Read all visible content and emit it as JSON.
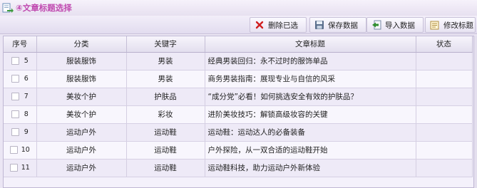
{
  "window": {
    "title": "④文章标题选择"
  },
  "toolbar": {
    "delete_label": "删除已选",
    "save_label": "保存数据",
    "import_label": "导入数据",
    "edit_label": "修改标题"
  },
  "table": {
    "headers": {
      "index": "序号",
      "category": "分类",
      "keyword": "关键字",
      "title": "文章标题",
      "status": "状态"
    },
    "rows": [
      {
        "index": "5",
        "category": "服装服饰",
        "keyword": "男装",
        "title": "经典男装回归：永不过时的服饰单品",
        "status": ""
      },
      {
        "index": "6",
        "category": "服装服饰",
        "keyword": "男装",
        "title": "商务男装指南：展现专业与自信的风采",
        "status": ""
      },
      {
        "index": "7",
        "category": "美妆个护",
        "keyword": "护肤品",
        "title": "“成分党”必看！如何挑选安全有效的护肤品？",
        "status": ""
      },
      {
        "index": "8",
        "category": "美妆个护",
        "keyword": "彩妆",
        "title": "进阶美妆技巧：解锁高级妆容的关键",
        "status": ""
      },
      {
        "index": "9",
        "category": "运动户外",
        "keyword": "运动鞋",
        "title": "运动鞋：运动达人的必备装备",
        "status": ""
      },
      {
        "index": "10",
        "category": "运动户外",
        "keyword": "运动鞋",
        "title": "户外探险，从一双合适的运动鞋开始",
        "status": ""
      },
      {
        "index": "11",
        "category": "运动户外",
        "keyword": "运动鞋",
        "title": "运动鞋科技，助力运动户外新体验",
        "status": ""
      }
    ]
  }
}
